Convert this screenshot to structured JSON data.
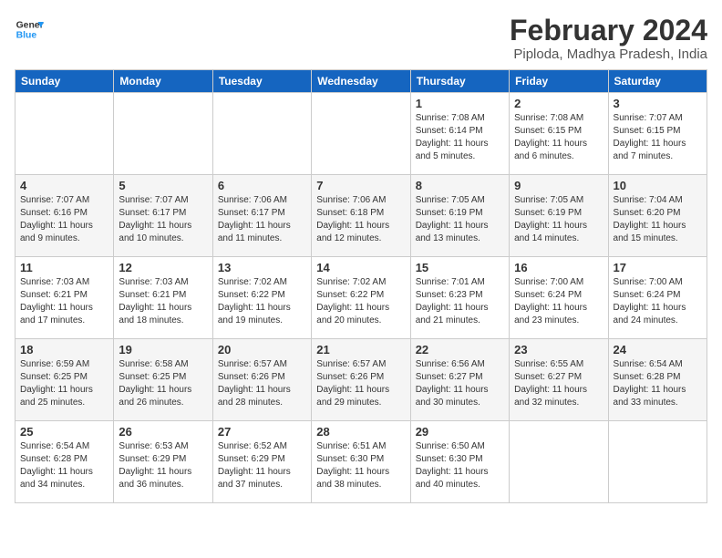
{
  "logo": {
    "line1": "General",
    "line2": "Blue"
  },
  "title": "February 2024",
  "subtitle": "Piploda, Madhya Pradesh, India",
  "days_header": [
    "Sunday",
    "Monday",
    "Tuesday",
    "Wednesday",
    "Thursday",
    "Friday",
    "Saturday"
  ],
  "weeks": [
    [
      {
        "day": "",
        "info": ""
      },
      {
        "day": "",
        "info": ""
      },
      {
        "day": "",
        "info": ""
      },
      {
        "day": "",
        "info": ""
      },
      {
        "day": "1",
        "info": "Sunrise: 7:08 AM\nSunset: 6:14 PM\nDaylight: 11 hours\nand 5 minutes."
      },
      {
        "day": "2",
        "info": "Sunrise: 7:08 AM\nSunset: 6:15 PM\nDaylight: 11 hours\nand 6 minutes."
      },
      {
        "day": "3",
        "info": "Sunrise: 7:07 AM\nSunset: 6:15 PM\nDaylight: 11 hours\nand 7 minutes."
      }
    ],
    [
      {
        "day": "4",
        "info": "Sunrise: 7:07 AM\nSunset: 6:16 PM\nDaylight: 11 hours\nand 9 minutes."
      },
      {
        "day": "5",
        "info": "Sunrise: 7:07 AM\nSunset: 6:17 PM\nDaylight: 11 hours\nand 10 minutes."
      },
      {
        "day": "6",
        "info": "Sunrise: 7:06 AM\nSunset: 6:17 PM\nDaylight: 11 hours\nand 11 minutes."
      },
      {
        "day": "7",
        "info": "Sunrise: 7:06 AM\nSunset: 6:18 PM\nDaylight: 11 hours\nand 12 minutes."
      },
      {
        "day": "8",
        "info": "Sunrise: 7:05 AM\nSunset: 6:19 PM\nDaylight: 11 hours\nand 13 minutes."
      },
      {
        "day": "9",
        "info": "Sunrise: 7:05 AM\nSunset: 6:19 PM\nDaylight: 11 hours\nand 14 minutes."
      },
      {
        "day": "10",
        "info": "Sunrise: 7:04 AM\nSunset: 6:20 PM\nDaylight: 11 hours\nand 15 minutes."
      }
    ],
    [
      {
        "day": "11",
        "info": "Sunrise: 7:03 AM\nSunset: 6:21 PM\nDaylight: 11 hours\nand 17 minutes."
      },
      {
        "day": "12",
        "info": "Sunrise: 7:03 AM\nSunset: 6:21 PM\nDaylight: 11 hours\nand 18 minutes."
      },
      {
        "day": "13",
        "info": "Sunrise: 7:02 AM\nSunset: 6:22 PM\nDaylight: 11 hours\nand 19 minutes."
      },
      {
        "day": "14",
        "info": "Sunrise: 7:02 AM\nSunset: 6:22 PM\nDaylight: 11 hours\nand 20 minutes."
      },
      {
        "day": "15",
        "info": "Sunrise: 7:01 AM\nSunset: 6:23 PM\nDaylight: 11 hours\nand 21 minutes."
      },
      {
        "day": "16",
        "info": "Sunrise: 7:00 AM\nSunset: 6:24 PM\nDaylight: 11 hours\nand 23 minutes."
      },
      {
        "day": "17",
        "info": "Sunrise: 7:00 AM\nSunset: 6:24 PM\nDaylight: 11 hours\nand 24 minutes."
      }
    ],
    [
      {
        "day": "18",
        "info": "Sunrise: 6:59 AM\nSunset: 6:25 PM\nDaylight: 11 hours\nand 25 minutes."
      },
      {
        "day": "19",
        "info": "Sunrise: 6:58 AM\nSunset: 6:25 PM\nDaylight: 11 hours\nand 26 minutes."
      },
      {
        "day": "20",
        "info": "Sunrise: 6:57 AM\nSunset: 6:26 PM\nDaylight: 11 hours\nand 28 minutes."
      },
      {
        "day": "21",
        "info": "Sunrise: 6:57 AM\nSunset: 6:26 PM\nDaylight: 11 hours\nand 29 minutes."
      },
      {
        "day": "22",
        "info": "Sunrise: 6:56 AM\nSunset: 6:27 PM\nDaylight: 11 hours\nand 30 minutes."
      },
      {
        "day": "23",
        "info": "Sunrise: 6:55 AM\nSunset: 6:27 PM\nDaylight: 11 hours\nand 32 minutes."
      },
      {
        "day": "24",
        "info": "Sunrise: 6:54 AM\nSunset: 6:28 PM\nDaylight: 11 hours\nand 33 minutes."
      }
    ],
    [
      {
        "day": "25",
        "info": "Sunrise: 6:54 AM\nSunset: 6:28 PM\nDaylight: 11 hours\nand 34 minutes."
      },
      {
        "day": "26",
        "info": "Sunrise: 6:53 AM\nSunset: 6:29 PM\nDaylight: 11 hours\nand 36 minutes."
      },
      {
        "day": "27",
        "info": "Sunrise: 6:52 AM\nSunset: 6:29 PM\nDaylight: 11 hours\nand 37 minutes."
      },
      {
        "day": "28",
        "info": "Sunrise: 6:51 AM\nSunset: 6:30 PM\nDaylight: 11 hours\nand 38 minutes."
      },
      {
        "day": "29",
        "info": "Sunrise: 6:50 AM\nSunset: 6:30 PM\nDaylight: 11 hours\nand 40 minutes."
      },
      {
        "day": "",
        "info": ""
      },
      {
        "day": "",
        "info": ""
      }
    ]
  ]
}
